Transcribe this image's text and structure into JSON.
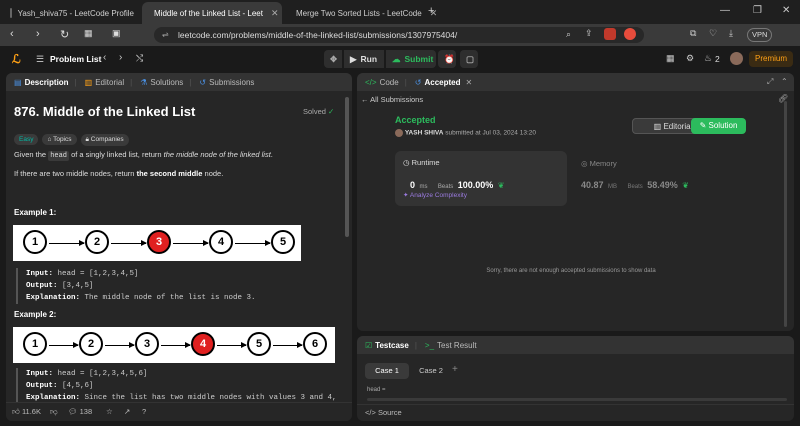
{
  "browser": {
    "tabs": [
      {
        "title": "Yash_shiva75 - LeetCode Profile",
        "active": false
      },
      {
        "title": "Middle of the Linked List - Leet",
        "active": true
      },
      {
        "title": "Merge Two Sorted Lists - LeetCode",
        "active": false
      }
    ],
    "url": "leetcode.com/problems/middle-of-the-linked-list/submissions/1307975404/",
    "vpn_label": "VPN",
    "new_tab_icon": "+"
  },
  "lc_nav": {
    "problem_list": "Problem List",
    "run": "Run",
    "submit": "Submit",
    "streak": "2",
    "premium": "Premium"
  },
  "left": {
    "tabs": [
      "Description",
      "Editorial",
      "Solutions",
      "Submissions"
    ],
    "title": "876. Middle of the Linked List",
    "solved": "Solved",
    "tags": [
      "Easy",
      "Topics",
      "Companies"
    ],
    "desc1_pre": "Given the ",
    "desc1_code": "head",
    "desc1_mid": " of a singly linked list, return ",
    "desc1_em": "the middle node of the linked list",
    "desc1_end": ".",
    "desc2_pre": "If there are two middle nodes, return ",
    "desc2_b": "the second middle",
    "desc2_end": " node.",
    "example1": {
      "heading": "Example 1:",
      "nodes": [
        "1",
        "2",
        "3",
        "4",
        "5"
      ],
      "highlight": 2,
      "input_label": "Input:",
      "input": " head = [1,2,3,4,5]",
      "output_label": "Output:",
      "output": " [3,4,5]",
      "expl_label": "Explanation:",
      "expl": " The middle node of the list is node 3."
    },
    "example2": {
      "heading": "Example 2:",
      "nodes": [
        "1",
        "2",
        "3",
        "4",
        "5",
        "6"
      ],
      "highlight": 3,
      "input_label": "Input:",
      "input": " head = [1,2,3,4,5,6]",
      "output_label": "Output:",
      "output": " [4,5,6]",
      "expl_label": "Explanation:",
      "expl": " Since the list has two middle nodes with values 3 and 4,"
    },
    "footer": {
      "likes": "11.6K",
      "comments": "138"
    }
  },
  "right": {
    "tabs": [
      "Code",
      "Accepted"
    ],
    "all_submissions": "All Submissions",
    "status": "Accepted",
    "user": "YASH SHIVA",
    "submitted": " submitted at Jul 03, 2024 13:20",
    "editorial_btn": "Editorial",
    "solution_btn": "Solution",
    "runtime": {
      "label": "Runtime",
      "value": "0",
      "unit": "ms",
      "beats_label": "Beats",
      "beats": "100.00%",
      "analyze": "Analyze Complexity"
    },
    "memory": {
      "label": "Memory",
      "value": "40.87",
      "unit": "MB",
      "beats_label": "Beats",
      "beats": "58.49%"
    },
    "no_data": "Sorry, there are not enough accepted submissions to show data",
    "testcase_tabs": [
      "Testcase",
      "Test Result"
    ],
    "cases": [
      "Case 1",
      "Case 2"
    ],
    "head_label": "head =",
    "source": "Source"
  },
  "colors": {
    "accent_green": "#2cbb5d",
    "accent_orange": "#ffa116",
    "red_node": "#e02020"
  }
}
